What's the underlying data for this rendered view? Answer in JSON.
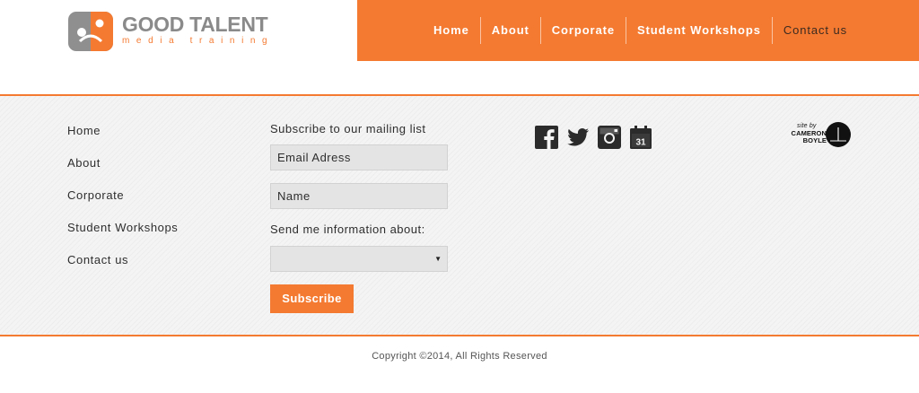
{
  "brand": {
    "title": "GOOD TALENT",
    "subtitle": "media training",
    "accent_color": "#f47a31",
    "logo_icon": "good-talent-logo-mark"
  },
  "nav": {
    "items": [
      {
        "label": "Home"
      },
      {
        "label": "About"
      },
      {
        "label": "Corporate"
      },
      {
        "label": "Student Workshops"
      },
      {
        "label": "Contact us"
      }
    ]
  },
  "footer_nav": {
    "items": [
      {
        "label": "Home"
      },
      {
        "label": "About"
      },
      {
        "label": "Corporate"
      },
      {
        "label": "Student Workshops"
      },
      {
        "label": "Contact us"
      }
    ]
  },
  "subscribe": {
    "heading": "Subscribe to our mailing list",
    "email_placeholder": "Email Adress",
    "name_placeholder": "Name",
    "send_label": "Send me information about:",
    "select_value": "",
    "button_label": "Subscribe"
  },
  "social": {
    "icons": [
      "facebook-icon",
      "twitter-icon",
      "instagram-icon",
      "calendar-icon"
    ],
    "calendar_day": "31"
  },
  "credit": {
    "small": "site by",
    "name_line1": "CAMERON",
    "name_line2": "BOYLE"
  },
  "copyright": "Copyright ©2014, All Rights Reserved"
}
